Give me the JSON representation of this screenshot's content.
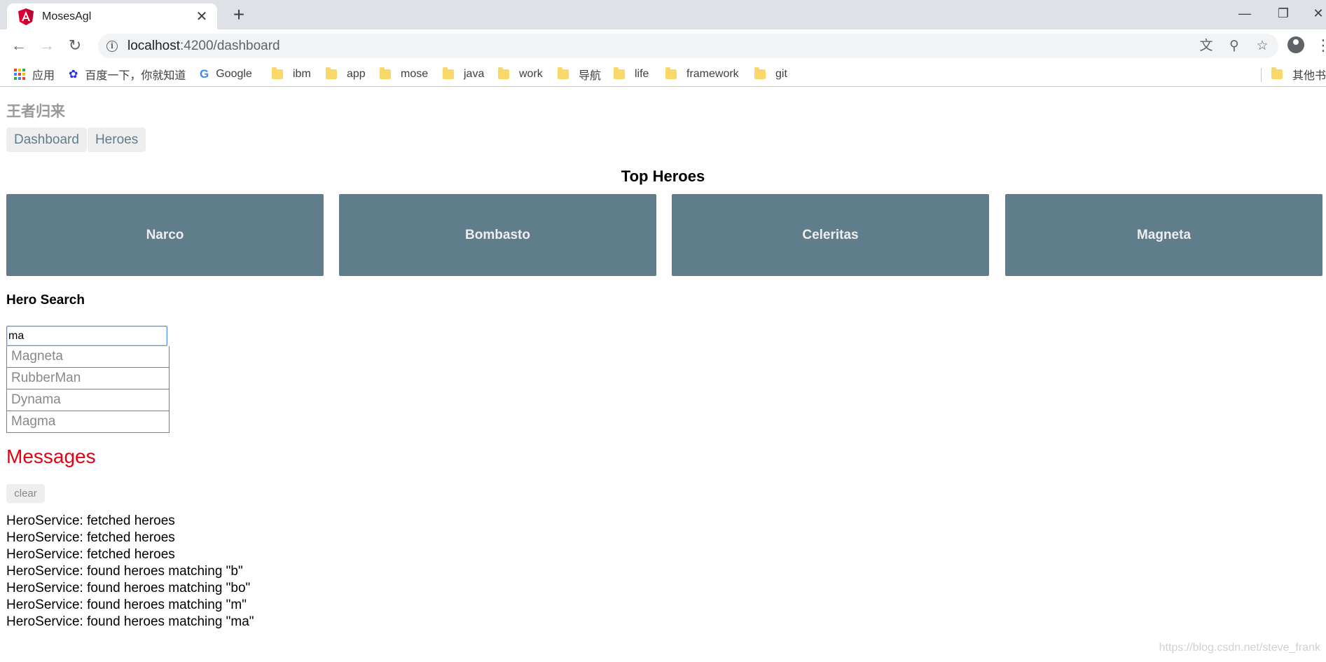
{
  "browser": {
    "tab_title": "MosesAgl",
    "tab_close": "✕",
    "new_tab": "+",
    "url_host": "localhost",
    "url_path": ":4200/dashboard",
    "window_controls": {
      "minimize": "—",
      "restore": "❐",
      "close": "✕"
    },
    "icons": [
      "back-icon",
      "forward-icon",
      "reload-icon",
      "info-icon",
      "translate-icon",
      "zoom-icon",
      "star-icon",
      "profile-icon",
      "menu-icon"
    ]
  },
  "bookmarks": {
    "apps": "应用",
    "baidu": "百度一下，你就知道",
    "google": "Google",
    "folders": [
      "ibm",
      "app",
      "mose",
      "java",
      "work",
      "导航",
      "life",
      "framework",
      "git"
    ],
    "other": "其他书签"
  },
  "page": {
    "app_title": "王者归来",
    "nav": [
      "Dashboard",
      "Heroes"
    ],
    "top_heroes_title": "Top Heroes",
    "top_heroes": [
      "Narco",
      "Bombasto",
      "Celeritas",
      "Magneta"
    ],
    "search_title": "Hero Search",
    "search_value": "ma",
    "search_results": [
      "Magneta",
      "RubberMan",
      "Dynama",
      "Magma"
    ],
    "messages_title": "Messages",
    "clear_label": "clear",
    "messages": [
      "HeroService: fetched heroes",
      "HeroService: fetched heroes",
      "HeroService: fetched heroes",
      "HeroService: found heroes matching \"b\"",
      "HeroService: found heroes matching \"bo\"",
      "HeroService: found heroes matching \"m\"",
      "HeroService: found heroes matching \"ma\""
    ],
    "watermark": "https://blog.csdn.net/steve_frank"
  },
  "colors": {
    "hero_card": "#607d8b",
    "nav_text": "#607d8b",
    "messages_heading": "#e60012",
    "title_gray": "#999999"
  }
}
